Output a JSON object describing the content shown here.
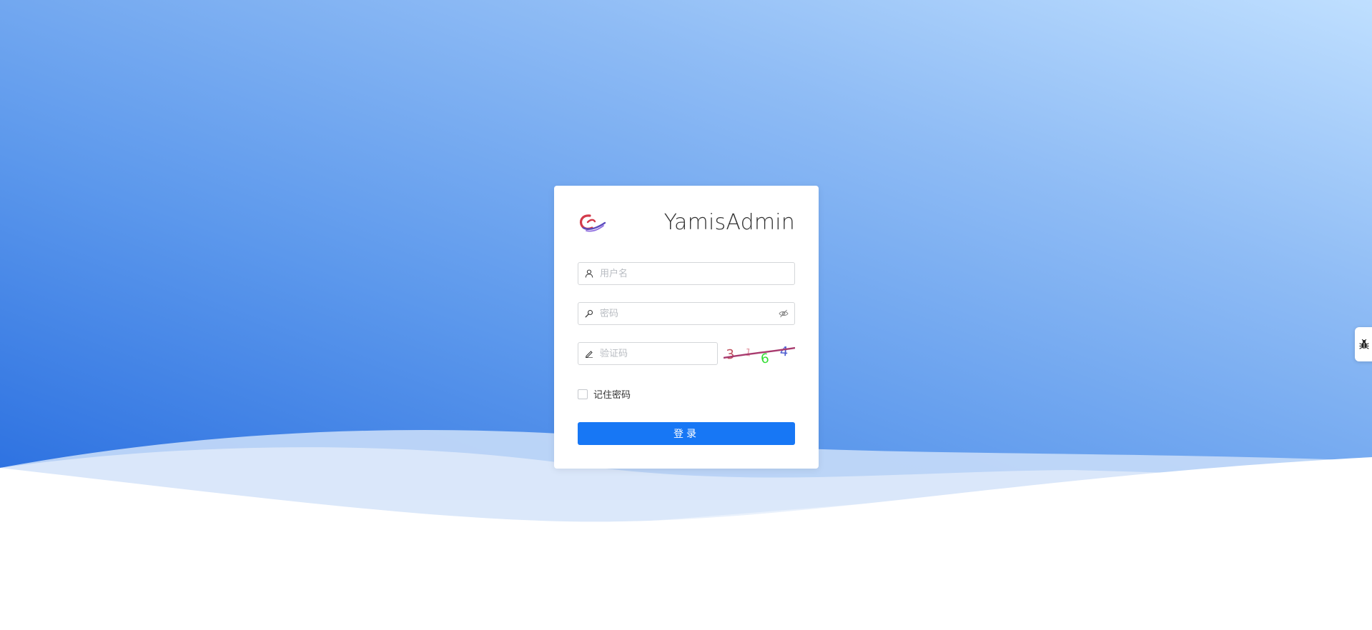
{
  "app": {
    "title": "YamisAdmin",
    "logo_icon": "yamis-logo-icon"
  },
  "form": {
    "username": {
      "icon": "user-icon",
      "placeholder": "用户名",
      "value": ""
    },
    "password": {
      "icon": "key-icon",
      "placeholder": "密码",
      "value": "",
      "toggle_icon": "eye-slash-icon"
    },
    "captcha": {
      "icon": "pencil-icon",
      "placeholder": "验证码",
      "value": "",
      "image_text": "3164"
    },
    "remember_label": "记住密码",
    "remember_checked": false,
    "submit_label": "登录"
  },
  "debug": {
    "icon": "bug-icon"
  },
  "colors": {
    "primary": "#1777f5",
    "background_gradient_start": "#2a6fe0",
    "background_gradient_end": "#bfdfff",
    "card": "#ffffff"
  }
}
